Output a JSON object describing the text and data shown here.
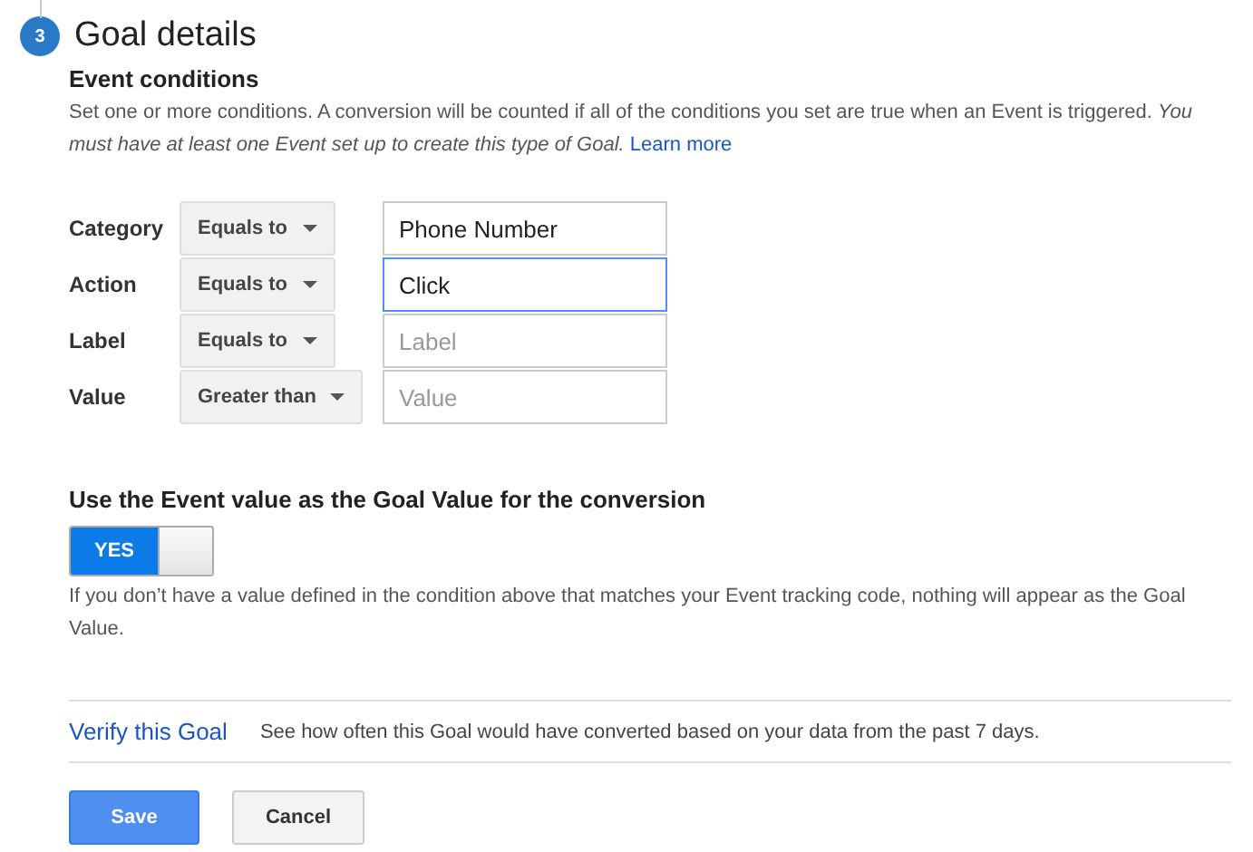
{
  "step": {
    "number": "3",
    "title": "Goal details"
  },
  "conditions": {
    "heading": "Event conditions",
    "text": "Set one or more conditions. A conversion will be counted if all of the conditions you set are true when an Event is triggered. *You must have at least one Event set up to create this type of Goal.*",
    "link": "Learn more",
    "rows": [
      {
        "label": "Category",
        "operator": "Equals to",
        "field": {
          "value": "Phone Number",
          "focused": false
        }
      },
      {
        "label": "Action",
        "operator": "Equals to",
        "field": {
          "value": "Click",
          "focused": true
        }
      },
      {
        "label": "Label",
        "operator": "Equals to",
        "field": {
          "placeholder": "Label",
          "focused": false
        }
      },
      {
        "label": "Value",
        "operator": "Greater than",
        "field": {
          "placeholder": "Value",
          "focused": false
        }
      }
    ]
  },
  "goal_value": {
    "heading": "Use the Event value as the Goal Value for the conversion",
    "toggle": {
      "label": "YES",
      "on": true
    },
    "note": "If you don’t have a value defined in the condition above that matches your Event tracking code, nothing will appear as the Goal Value."
  },
  "verify": {
    "link": "Verify this Goal",
    "text": "See how often this Goal would have converted based on your data from the past 7 days."
  },
  "buttons": [
    {
      "label": "Save",
      "kind": "primary"
    },
    {
      "label": "Cancel",
      "kind": "secondary"
    }
  ]
}
